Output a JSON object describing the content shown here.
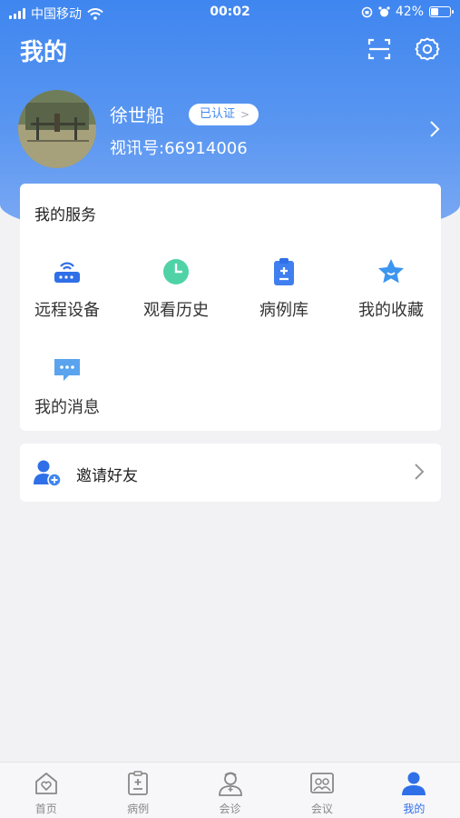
{
  "status_bar": {
    "carrier": "中国移动",
    "time": "00:02",
    "battery": "42%",
    "battery_level": 0.42
  },
  "header": {
    "title": "我的"
  },
  "profile": {
    "name": "徐世船",
    "verified_label": "已认证",
    "account_id": "视讯号:66914006"
  },
  "services": {
    "title": "我的服务",
    "items": [
      {
        "label": "远程设备",
        "icon": "remote-device-icon"
      },
      {
        "label": "观看历史",
        "icon": "clock-icon"
      },
      {
        "label": "病例库",
        "icon": "clipboard-icon"
      },
      {
        "label": "我的收藏",
        "icon": "star-icon"
      },
      {
        "label": "我的消息",
        "icon": "message-icon"
      }
    ]
  },
  "invite": {
    "label": "邀请好友"
  },
  "tabbar": {
    "items": [
      {
        "label": "首页",
        "icon": "home-icon"
      },
      {
        "label": "病例",
        "icon": "case-icon"
      },
      {
        "label": "会诊",
        "icon": "doctor-icon"
      },
      {
        "label": "会议",
        "icon": "meeting-icon"
      },
      {
        "label": "我的",
        "icon": "person-icon"
      }
    ],
    "active_index": 4
  },
  "colors": {
    "primary": "#3f86f0",
    "active_tab": "#2f6fe8",
    "background": "#f2f2f4"
  }
}
